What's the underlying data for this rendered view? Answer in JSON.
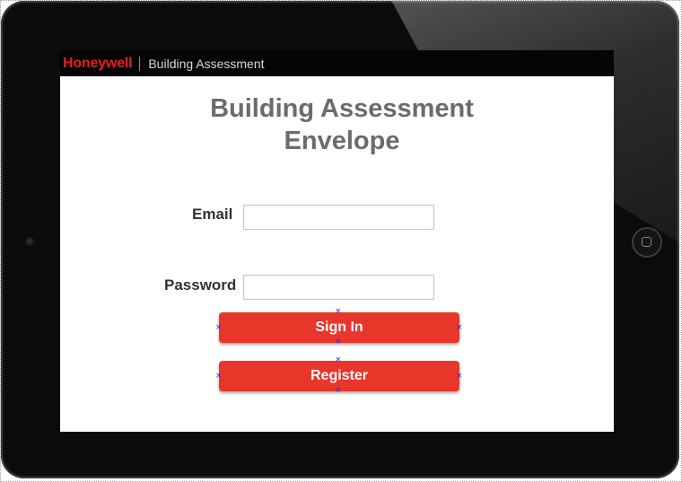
{
  "header": {
    "brand": "Honeywell",
    "title": "Building Assessment"
  },
  "page": {
    "title_line1": "Building Assessment",
    "title_line2": "Envelope"
  },
  "form": {
    "email_label": "Email",
    "email_value": "",
    "password_label": "Password",
    "password_value": ""
  },
  "buttons": {
    "sign_in": "Sign In",
    "register": "Register"
  },
  "colors": {
    "brand_red": "#e0201b",
    "button_red": "#e8362b",
    "title_gray": "#6b6b6b"
  }
}
